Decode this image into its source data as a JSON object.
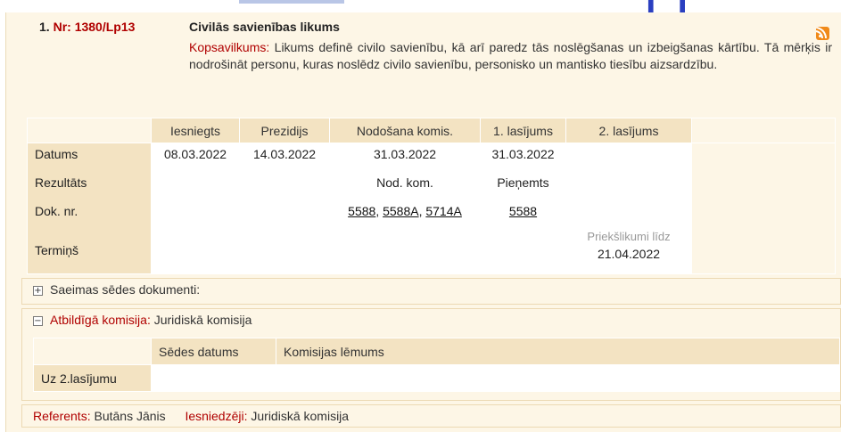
{
  "bill": {
    "index": "1.",
    "nr": "Nr: 1380/Lp13",
    "title": "Civilās savienības likums",
    "summary_label": "Kopsavilkums:",
    "summary_text": "Likums definē civilo savienību, kā arī paredz tās noslēgšanas un izbeigšanas kārtību. Tā mērķis ir nodrošināt personu, kuras noslēdz civilo savienību, personisko un mantisko tiesību aizsardzību.",
    "rss_icon": "rss-feed-icon"
  },
  "stages": {
    "headers": [
      "Iesniegts",
      "Prezidijs",
      "Nodošana komis.",
      "1. lasījums",
      "2. lasījums"
    ],
    "row_labels": {
      "datums": "Datums",
      "rezultats": "Rezultāts",
      "dok_nr": "Dok. nr.",
      "termins": "Termiņš"
    },
    "datums": [
      "08.03.2022",
      "14.03.2022",
      "31.03.2022",
      "31.03.2022",
      ""
    ],
    "rezultats": [
      "",
      "",
      "Nod. kom.",
      "Pieņemts",
      ""
    ],
    "dok_nr_nodosana": [
      "5588",
      "5588A",
      "5714A"
    ],
    "dok_nr_lasijums1": "5588",
    "termins_label": "Priekšlikumi līdz",
    "termins_date": "21.04.2022"
  },
  "saeimas": {
    "toggle": "+",
    "label": "Saeimas sēdes dokumenti:"
  },
  "komisija": {
    "toggle": "−",
    "label": "Atbildīgā komisija:",
    "value": "Juridiskā komisija",
    "headers": [
      "Sēdes datums",
      "Komisijas lēmums"
    ],
    "row_label": "Uz 2.lasījumu"
  },
  "footer": {
    "referents_label": "Referents:",
    "referents_value": "Butāns Jānis",
    "iesniedzeji_label": "Iesniedzēji:",
    "iesniedzeji_value": "Juridiskā komisija"
  }
}
